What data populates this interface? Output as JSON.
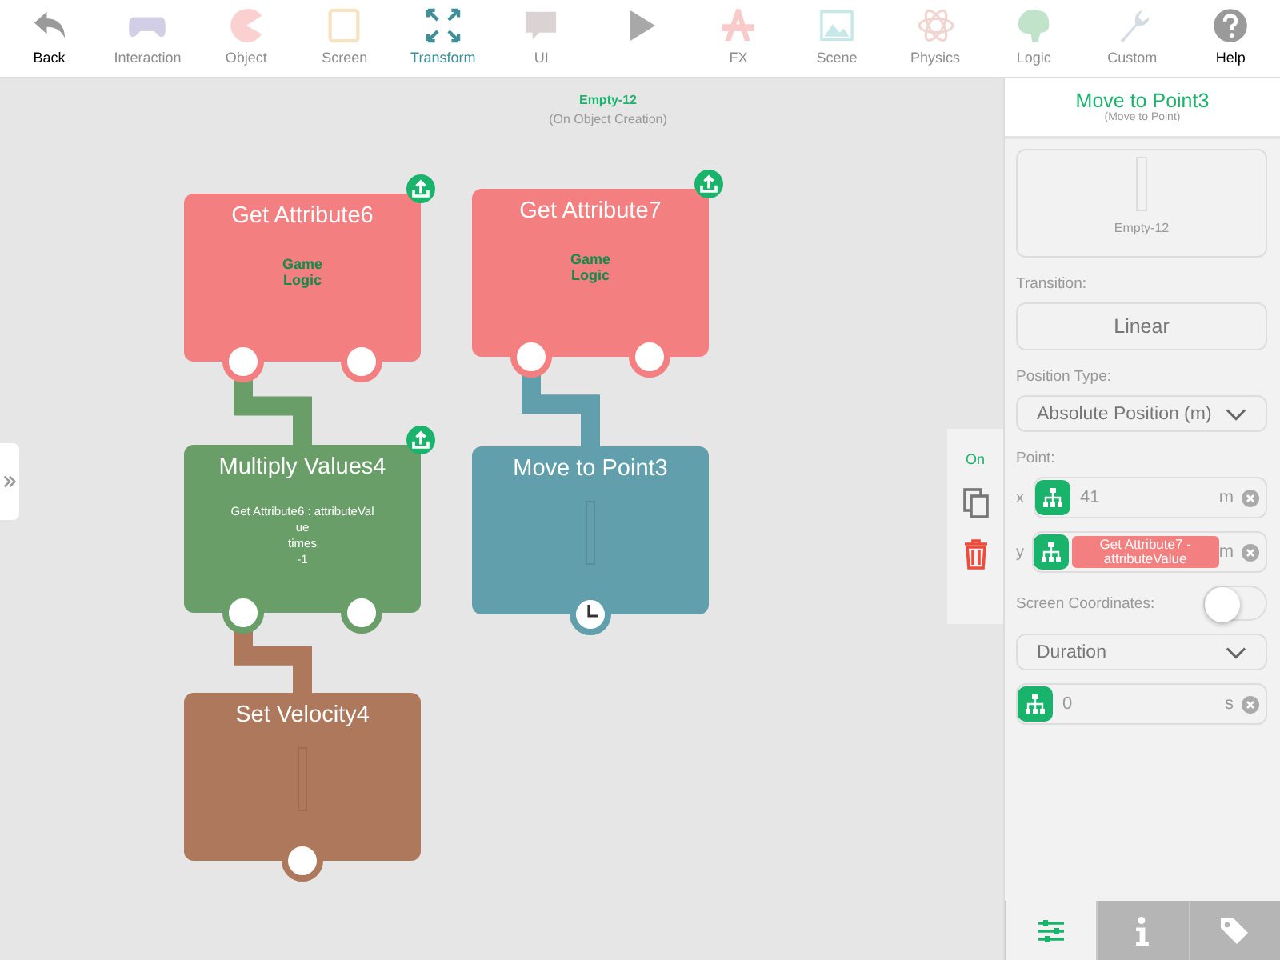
{
  "toolbar": {
    "back": "Back",
    "categories_left": [
      {
        "label": "Interaction",
        "selected": false
      },
      {
        "label": "Object",
        "selected": false
      },
      {
        "label": "Screen",
        "selected": false
      },
      {
        "label": "Transform",
        "selected": true
      },
      {
        "label": "UI",
        "selected": false
      }
    ],
    "categories_right": [
      {
        "label": "FX",
        "selected": false
      },
      {
        "label": "Scene",
        "selected": false
      },
      {
        "label": "Physics",
        "selected": false
      },
      {
        "label": "Logic",
        "selected": false
      },
      {
        "label": "Custom",
        "selected": false
      }
    ],
    "help": "Help"
  },
  "canvas": {
    "object_name": "Empty-12",
    "event": "(On Object Creation)",
    "nodes": [
      {
        "kind": "attribute",
        "title": "Get Attribute6",
        "color": "#f47f80",
        "body": [
          "Game",
          "Logic"
        ],
        "badge": true
      },
      {
        "kind": "attribute",
        "title": "Get Attribute7",
        "color": "#f47f80",
        "body": [
          "Game",
          "Logic"
        ],
        "badge": true
      },
      {
        "kind": "math",
        "title": "Multiply Values4",
        "color": "#6a9e69",
        "body": [
          "Get Attribute6 : attributeVal",
          "ue",
          "times",
          "-1"
        ],
        "badge": true
      },
      {
        "kind": "timed",
        "title": "Move to Point3",
        "color": "#609fab",
        "badge": false
      },
      {
        "kind": "behavior",
        "title": "Set Velocity4",
        "color": "#ad785c",
        "badge": false
      }
    ],
    "side_actions": {
      "toggle_label": "On"
    }
  },
  "panel": {
    "title": "Move to Point3",
    "subtitle": "(Move to Point)",
    "preview_label": "Empty-12",
    "transition_label": "Transition:",
    "transition": "Linear",
    "position_type_label": "Position Type:",
    "position_type": "Absolute Position (m)",
    "point_label": "Point:",
    "point": [
      {
        "axis": "x",
        "kind": "value",
        "value": "41",
        "unit": "m"
      },
      {
        "axis": "y",
        "kind": "reference",
        "tag": "Get Attribute7 - attributeValue",
        "unit": "m"
      }
    ],
    "screen_coordinates": {
      "label": "Screen Coordinates:",
      "on": false
    },
    "timing": "Duration",
    "timing_field": {
      "kind": "value",
      "value": "0",
      "unit": "s"
    },
    "tabs": [
      {
        "selected": true
      },
      {
        "selected": false
      },
      {
        "selected": false
      }
    ]
  }
}
